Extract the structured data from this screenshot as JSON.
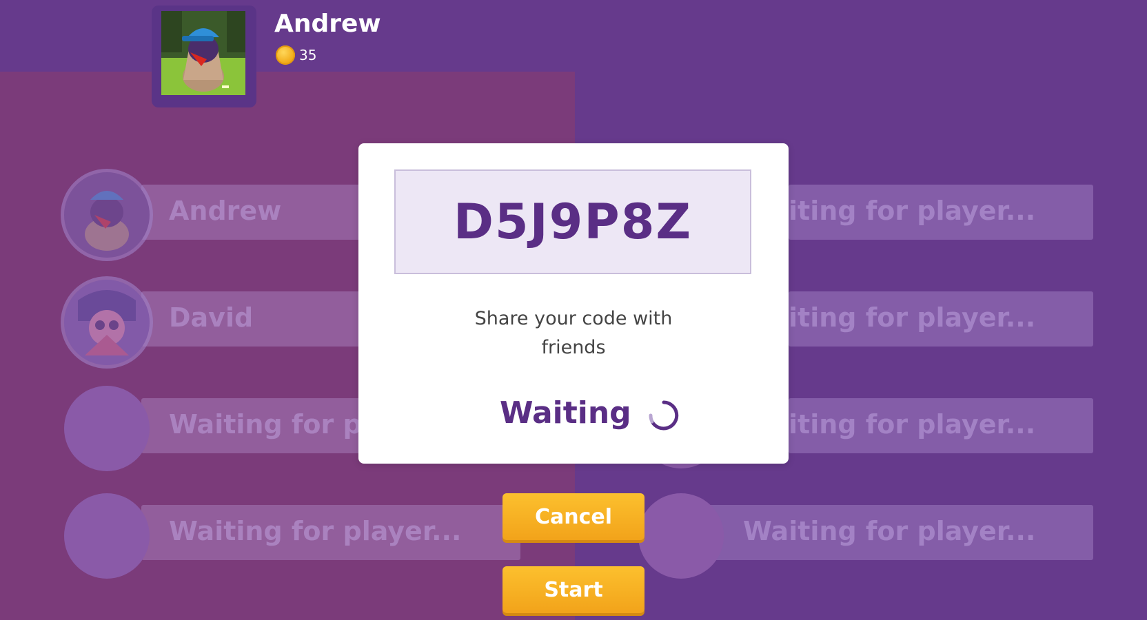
{
  "profile": {
    "name": "Andrew",
    "coins": "35"
  },
  "slots": {
    "left": [
      {
        "label": "Andrew"
      },
      {
        "label": "David"
      },
      {
        "label": "Waiting for pl"
      },
      {
        "label": "Waiting for player..."
      }
    ],
    "right": [
      {
        "label": "iting for player..."
      },
      {
        "label": "iting for player..."
      },
      {
        "label": "iting for player..."
      },
      {
        "label": "Waiting for player..."
      }
    ]
  },
  "modal": {
    "code": "D5J9P8Z",
    "share_line1": "Share your code with",
    "share_line2": "friends",
    "status": "Waiting"
  },
  "buttons": {
    "cancel": "Cancel",
    "start": "Start"
  },
  "colors": {
    "background_purple": "#663a8c",
    "left_panel": "#7b3b7a",
    "accent_purple": "#5a2e85",
    "button_yellow": "#f7b221"
  },
  "icons": {
    "coin": "coin-icon",
    "spinner": "loading-spinner-icon"
  }
}
